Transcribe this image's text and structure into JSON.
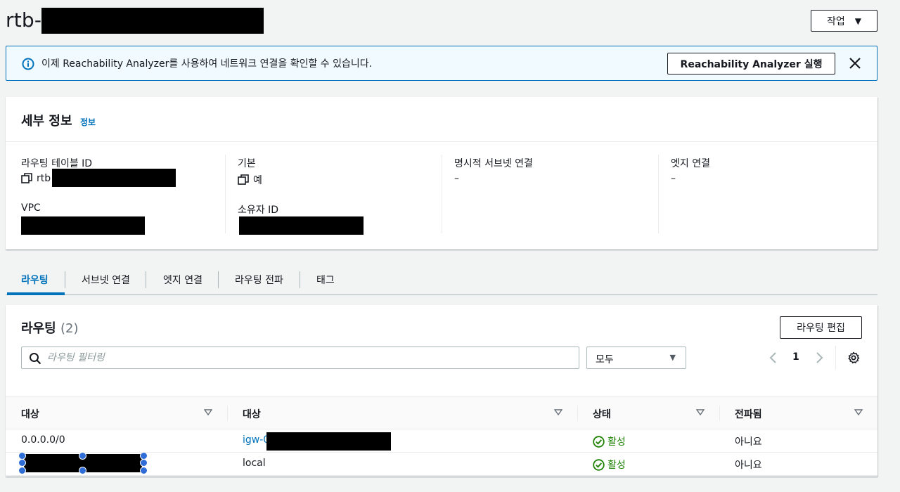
{
  "header": {
    "title": "rtb-",
    "action_label": "작업"
  },
  "flash": {
    "message": "이제 Reachability Analyzer를 사용하여 네트워크 연결을 확인할 수 있습니다.",
    "button_label": "Reachability Analyzer 실행"
  },
  "details": {
    "title": "세부 정보",
    "info_link": "정보",
    "fields": {
      "route_table_id_label": "라우팅 테이블 ID",
      "route_table_id_value": "rtb",
      "main_label": "기본",
      "main_value": "예",
      "explicit_subnet_label": "명시적 서브넷 연결",
      "explicit_subnet_value": "–",
      "edge_label": "엣지 연결",
      "edge_value": "–",
      "vpc_label": "VPC",
      "owner_label": "소유자 ID"
    }
  },
  "tabs": [
    {
      "label": "라우팅",
      "active": true
    },
    {
      "label": "서브넷 연결",
      "active": false
    },
    {
      "label": "엣지 연결",
      "active": false
    },
    {
      "label": "라우팅 전파",
      "active": false
    },
    {
      "label": "태그",
      "active": false
    }
  ],
  "routes": {
    "title": "라우팅",
    "count": "(2)",
    "edit_label": "라우팅 편집",
    "search_placeholder": "라우팅 필터링",
    "filter_value": "모두",
    "page": "1",
    "columns": [
      "대상",
      "대상",
      "상태",
      "전파됨"
    ],
    "rows": [
      {
        "destination": "0.0.0.0/0",
        "target": "igw-0",
        "status": "활성",
        "propagated": "아니요"
      },
      {
        "destination": "",
        "target": "local",
        "status": "활성",
        "propagated": "아니요"
      }
    ]
  },
  "colors": {
    "accent": "#0073bb",
    "status_active": "#1d8102",
    "flash_bg": "#f1faff"
  }
}
